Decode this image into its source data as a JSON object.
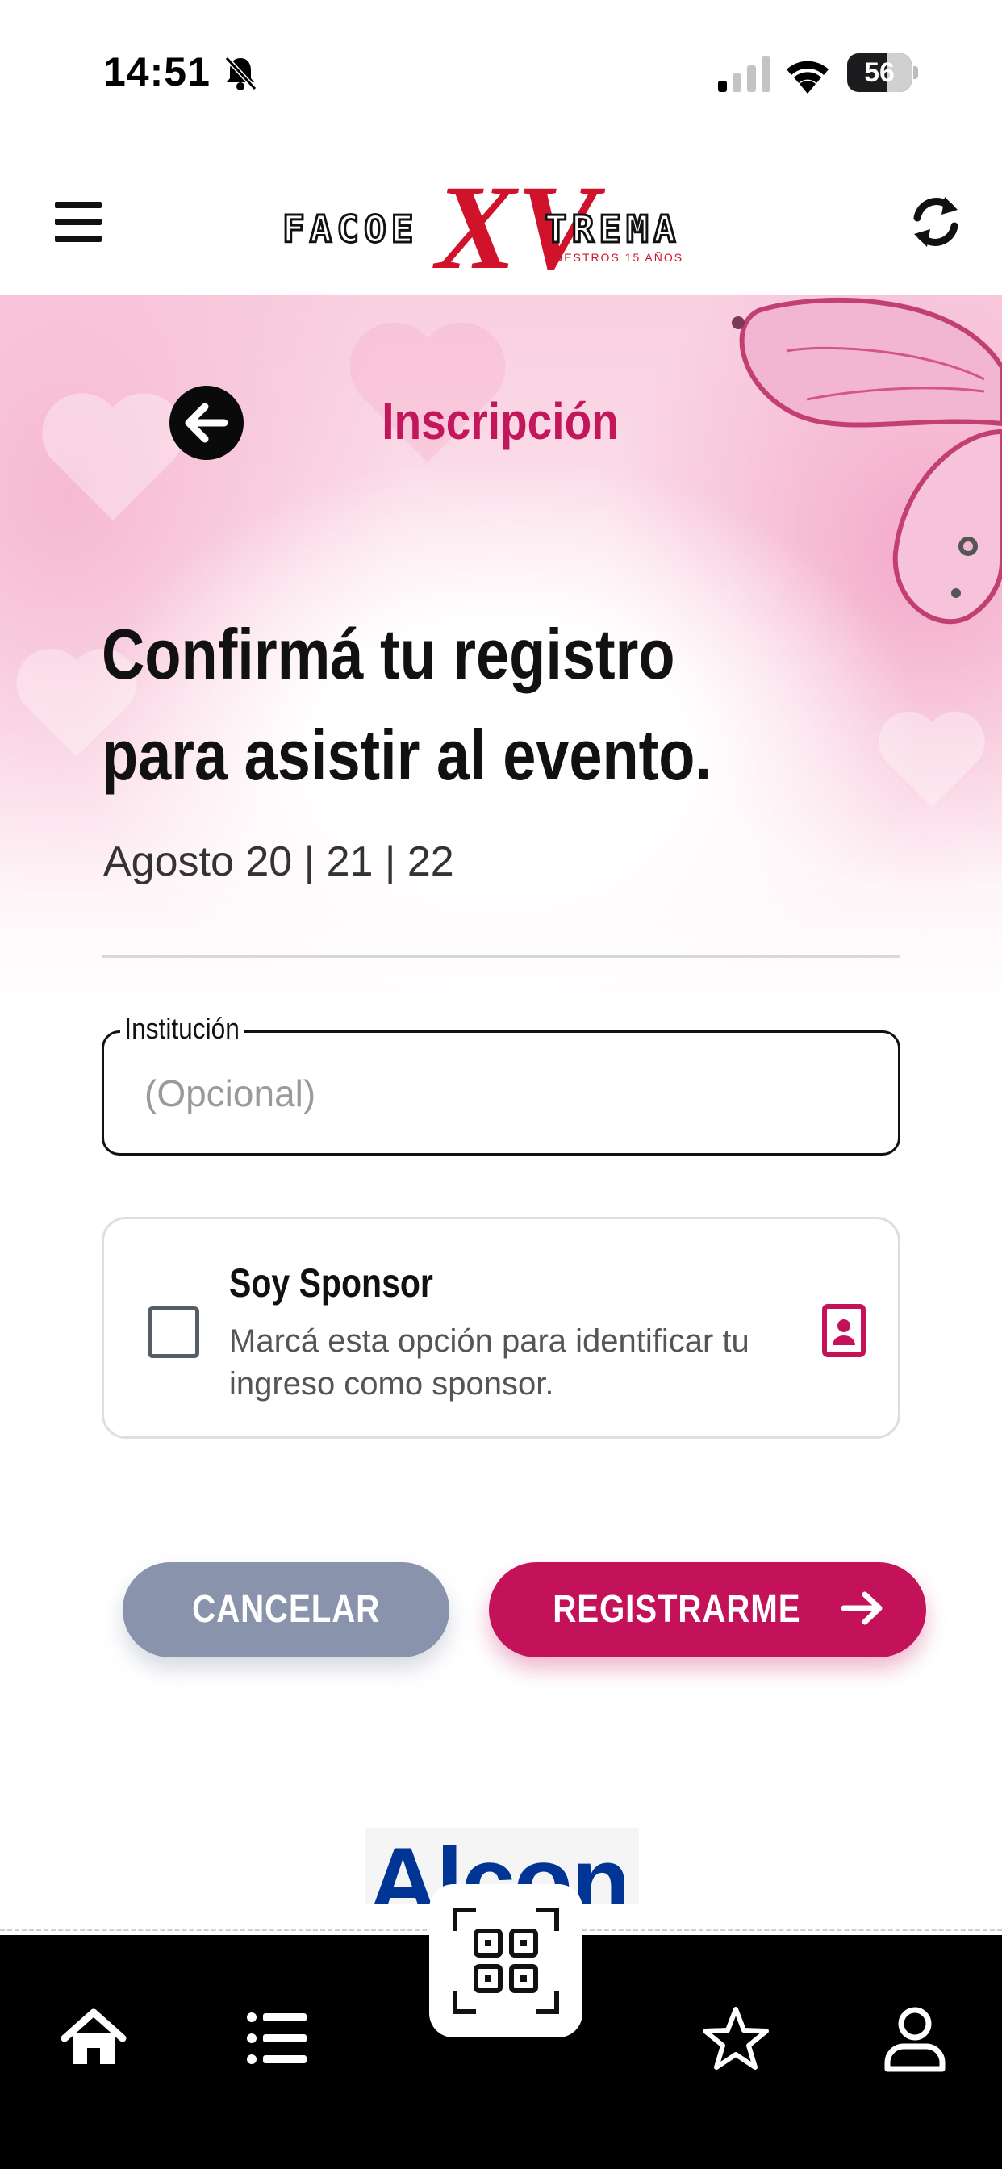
{
  "status_bar": {
    "time": "14:51",
    "battery": "56",
    "icons": [
      "bell-muted-icon",
      "cellular-signal-icon",
      "wifi-icon",
      "battery-icon"
    ]
  },
  "header": {
    "logo_text_left": "FACOE",
    "logo_text_xv": "XV",
    "logo_text_right": "TREMA",
    "logo_subtitle": "NUESTROS 15 AÑOS",
    "icons": [
      "hamburger-menu-icon",
      "refresh-icon"
    ]
  },
  "page": {
    "title": "Inscripción",
    "headline": "Confirmá tu registro para asistir al evento.",
    "dates": "Agosto 20 | 21 | 22"
  },
  "form": {
    "institution_label": "Institución",
    "institution_placeholder": "(Opcional)",
    "institution_value": ""
  },
  "sponsor": {
    "title": "Soy Sponsor",
    "description": "Marcá esta opción para identificar tu ingreso como sponsor.",
    "checked": false,
    "icon": "id-badge-icon"
  },
  "actions": {
    "cancel_label": "CANCELAR",
    "register_label": "REGISTRARME"
  },
  "sponsor_logo": "Alcon",
  "bottom_nav": {
    "items": [
      "home-icon",
      "list-icon",
      "qr-code-icon",
      "star-icon",
      "user-icon"
    ]
  },
  "colors": {
    "accent": "#c4125a",
    "title_pink": "#c2185b",
    "cancel_gray": "#8a93ac",
    "nav_background": "#000000",
    "alcon_blue": "#003595"
  }
}
